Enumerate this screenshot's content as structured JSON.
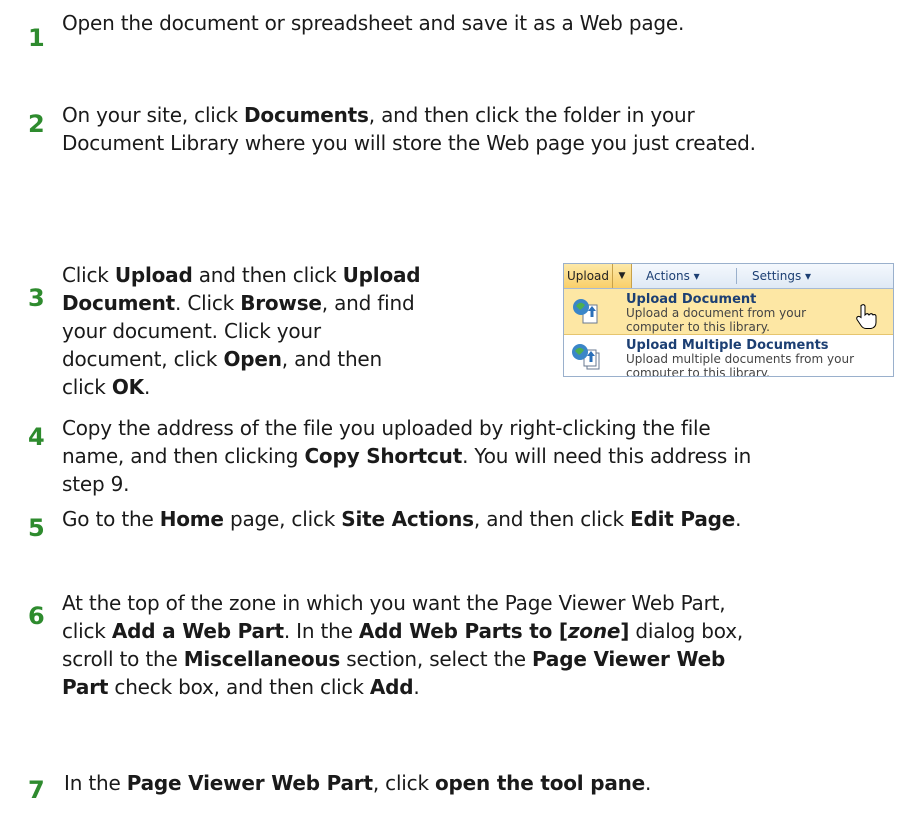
{
  "steps": [
    {
      "num": "1",
      "lines": [
        "Open the document or spreadsheet and save it as a Web page."
      ]
    },
    {
      "num": "2",
      "lines": [
        "On your site, click <b>Documents</b>, and then click the folder in your",
        "Document Library where you will store the Web page you just created."
      ]
    },
    {
      "num": "3",
      "lines": [
        "Click <b>Upload</b> and then click <b>Upload</b>",
        "<b>Document</b>. Click <b>Browse</b>, and find",
        "your document. Click your",
        "document, click <b>Open</b>, and then",
        "click <b>OK</b>."
      ]
    },
    {
      "num": "4",
      "lines": [
        "Copy the address of the file you uploaded by right-clicking the file",
        "name, and then clicking <b>Copy Shortcut</b>. You will need this address in",
        "step 9."
      ]
    },
    {
      "num": "5",
      "lines": [
        "Go to the <b>Home</b> page, click <b>Site Actions</b>, and then click <b>Edit Page</b>."
      ]
    },
    {
      "num": "6",
      "lines": [
        "At the top of the zone in which you want the Page Viewer Web Part,",
        "click <b>Add a Web Part</b>. In the <b>Add Web Parts to [<i>zone</i>]</b> dialog box,",
        "scroll to the <b>Miscellaneous</b> section, select the <b>Page Viewer Web</b>",
        "<b>Part</b> check box, and then click <b>Add</b>."
      ]
    },
    {
      "num": "7",
      "lines": [
        " In the <b>Page Viewer Web Part</b>, click <b>open the tool pane</b>."
      ]
    }
  ],
  "menu": {
    "toolbar": {
      "upload": "Upload",
      "actions": "Actions ▾",
      "settings": "Settings ▾"
    },
    "items": [
      {
        "title": "Upload Document",
        "desc1": "Upload a document from your",
        "desc2": "computer to this library."
      },
      {
        "title": "Upload Multiple Documents",
        "desc1": "Upload multiple documents from your",
        "desc2": "computer to this library."
      }
    ],
    "icons": {
      "item1": "upload-document-icon",
      "item2": "upload-multiple-documents-icon",
      "cursor": "hand-cursor-icon",
      "dropdown": "dropdown-arrow-icon"
    },
    "colors": {
      "highlight": "#fde7a4",
      "accent": "#1c3f73",
      "step_number": "#2e8b2e"
    }
  }
}
